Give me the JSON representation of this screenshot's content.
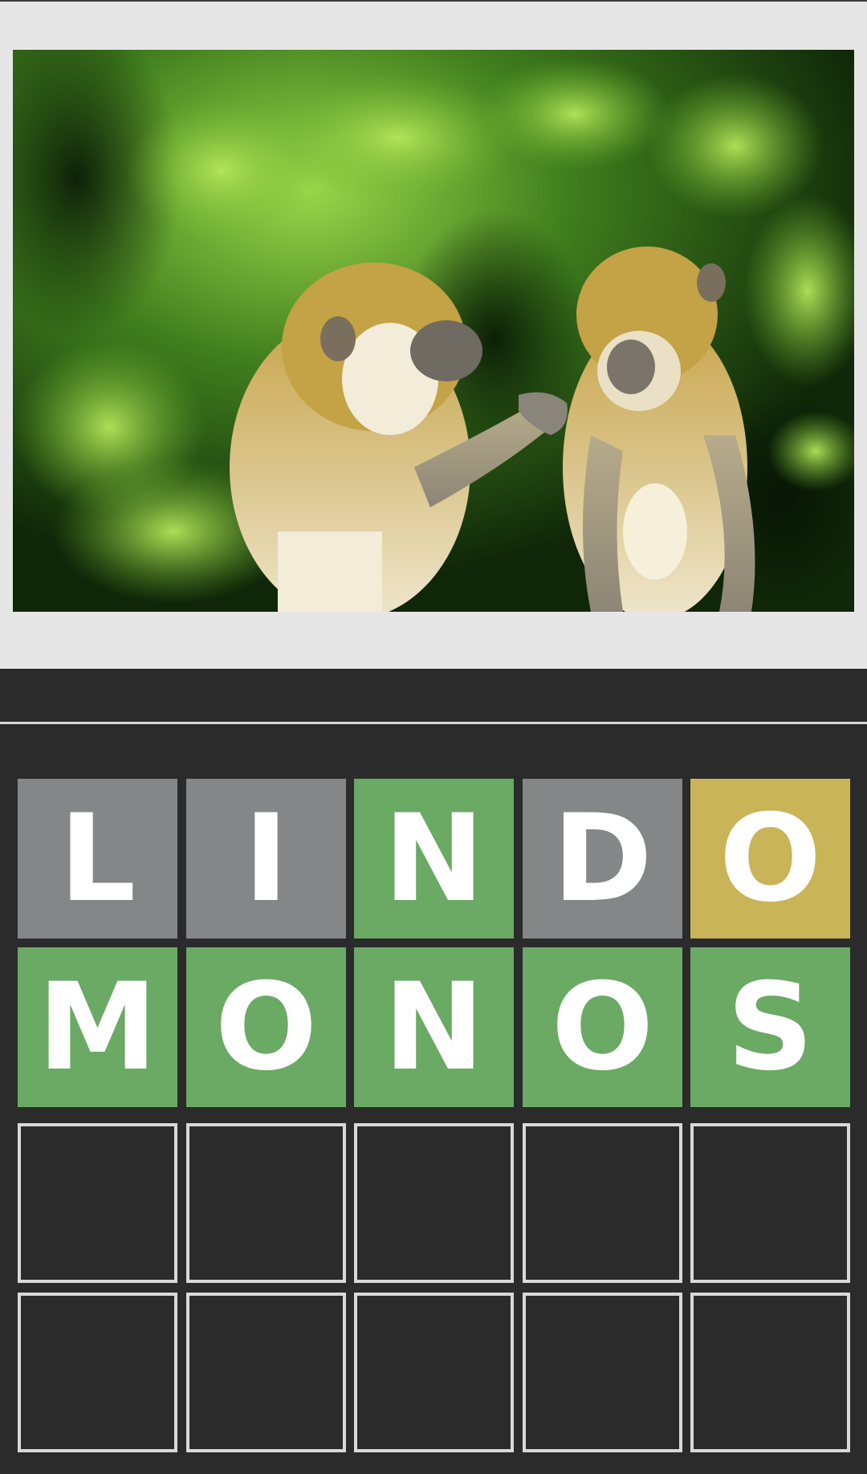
{
  "image": {
    "subject": "two-macaques-grooming-photo",
    "colors": {
      "panel_background": "#e6e6e6",
      "foliage_dark": "#1b3a10",
      "foliage_light": "#8ccf3a",
      "fur": "#c8a64a"
    }
  },
  "board": {
    "colors": {
      "background": "#2b2b2b",
      "absent": "#858688",
      "correct": "#6aaa64",
      "present": "#c9b458",
      "empty_border": "#d9d9d9",
      "letter": "#ffffff"
    },
    "rows": [
      {
        "tiles": [
          {
            "letter": "L",
            "state": "absent"
          },
          {
            "letter": "I",
            "state": "absent"
          },
          {
            "letter": "N",
            "state": "correct"
          },
          {
            "letter": "D",
            "state": "absent"
          },
          {
            "letter": "O",
            "state": "present"
          }
        ]
      },
      {
        "tiles": [
          {
            "letter": "M",
            "state": "correct"
          },
          {
            "letter": "O",
            "state": "correct"
          },
          {
            "letter": "N",
            "state": "correct"
          },
          {
            "letter": "O",
            "state": "correct"
          },
          {
            "letter": "S",
            "state": "correct"
          }
        ]
      },
      {
        "tiles": [
          {
            "letter": "",
            "state": "empty"
          },
          {
            "letter": "",
            "state": "empty"
          },
          {
            "letter": "",
            "state": "empty"
          },
          {
            "letter": "",
            "state": "empty"
          },
          {
            "letter": "",
            "state": "empty"
          }
        ]
      },
      {
        "tiles": [
          {
            "letter": "",
            "state": "empty"
          },
          {
            "letter": "",
            "state": "empty"
          },
          {
            "letter": "",
            "state": "empty"
          },
          {
            "letter": "",
            "state": "empty"
          },
          {
            "letter": "",
            "state": "empty"
          }
        ]
      }
    ]
  }
}
